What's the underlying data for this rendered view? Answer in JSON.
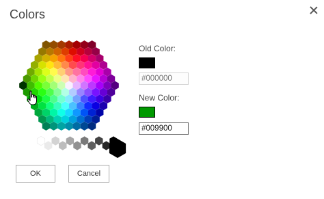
{
  "dialog": {
    "title": "Colors"
  },
  "palette": {
    "gray_colors": [
      "#ffffff",
      "#eaeaea",
      "#d3d3d3",
      "#bdbdbd",
      "#a7a7a7",
      "#919191",
      "#7a7a7a",
      "#5f5f5f",
      "#444444",
      "#262626",
      "#000000"
    ],
    "selected_big_color": "#000000"
  },
  "old_color": {
    "label": "Old Color:",
    "swatch": "#000000",
    "placeholder": "#000000"
  },
  "new_color": {
    "label": "New Color:",
    "swatch": "#009900",
    "value": "#009900"
  },
  "buttons": {
    "ok": "OK",
    "cancel": "Cancel"
  }
}
